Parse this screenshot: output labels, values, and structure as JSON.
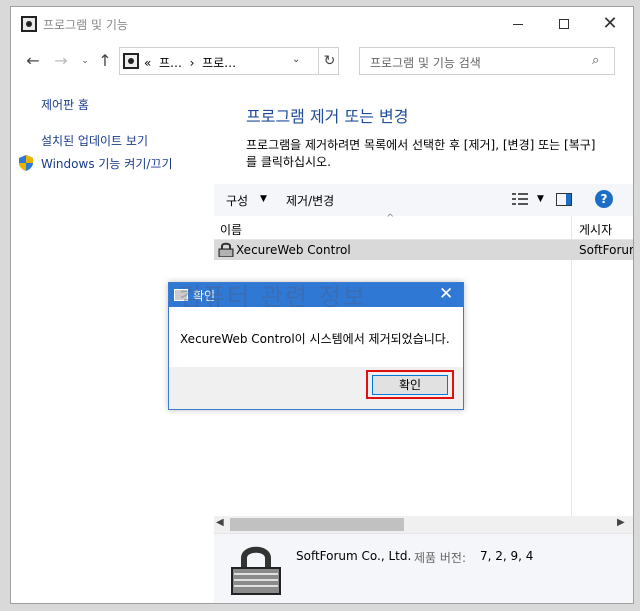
{
  "window": {
    "title": "프로그램 및 기능"
  },
  "nav": {
    "back": "←",
    "forward": "→",
    "recent": "⌄",
    "up": "↑",
    "address": "«  프…  ›  프로…",
    "refresh": "↻",
    "search_placeholder": "프로그램 및 기능 검색"
  },
  "left": {
    "home": "제어판 홈",
    "updates": "설치된 업데이트 보기",
    "features": "Windows 기능 켜기/끄기"
  },
  "main": {
    "title": "프로그램 제거 또는 변경",
    "description": "프로그램을 제거하려면 목록에서 선택한 후 [제거], [변경] 또는 [복구]를 클릭하십시오."
  },
  "toolbar": {
    "organize": "구성",
    "change": "제거/변경",
    "help": "?"
  },
  "list": {
    "columns": [
      "이름",
      "게시자"
    ],
    "rows": [
      {
        "name": "XecureWeb Control",
        "publisher": "SoftForum Co., Ltd."
      }
    ]
  },
  "details": {
    "company": "SoftForum Co., Ltd.",
    "version_label": "제품 버전:",
    "version": "7, 2, 9, 4"
  },
  "dialog": {
    "title": "확인",
    "watermark": "컴퓨터 관련 정보",
    "message": "XecureWeb Control이 시스템에서 제거되었습니다.",
    "ok": "확인"
  },
  "colors": {
    "accent": "#2f78d4",
    "link": "#1a3d8f",
    "highlight": "#e01010"
  }
}
